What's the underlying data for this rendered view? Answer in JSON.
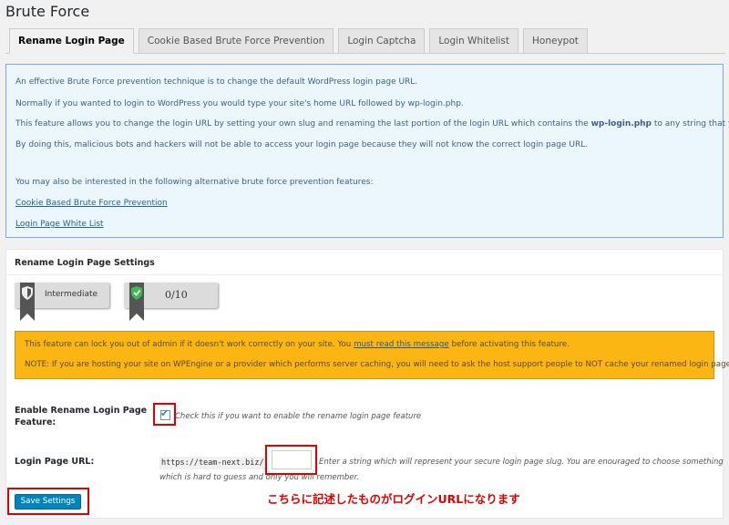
{
  "page": {
    "title": "Brute Force"
  },
  "tabs": [
    {
      "label": "Rename Login Page",
      "active": true
    },
    {
      "label": "Cookie Based Brute Force Prevention",
      "active": false
    },
    {
      "label": "Login Captcha",
      "active": false
    },
    {
      "label": "Login Whitelist",
      "active": false
    },
    {
      "label": "Honeypot",
      "active": false
    }
  ],
  "info": {
    "line1": "An effective Brute Force prevention technique is to change the default WordPress login page URL.",
    "line2": "Normally if you wanted to login to WordPress you would type your site's home URL followed by wp-login.php.",
    "line3_pre": "This feature allows you to change the login URL by setting your own slug and renaming the last portion of the login URL which contains the ",
    "line3_bold": "wp-login.php",
    "line3_post": " to any string that you like.",
    "line4": "By doing this, malicious bots and hackers will not be able to access your login page because they will not know the correct login page URL.",
    "line5": "You may also be interested in the following alternative brute force prevention features:",
    "link1": "Cookie Based Brute Force Prevention",
    "link2": "Login Page White List"
  },
  "settings": {
    "title": "Rename Login Page Settings",
    "badge_level": "Intermediate",
    "badge_score": "0/10",
    "warning_pre": "This feature can lock you out of admin if it doesn't work correctly on your site. You ",
    "warning_link": "must read this message",
    "warning_post": " before activating this feature.",
    "warning_note": "NOTE: If you are hosting your site on WPEngine or a provider which performs server caching, you will need to ask the host support people to NOT cache your renamed login page.",
    "enable_label_1": "Enable Rename Login Page",
    "enable_label_2": "Feature:",
    "enable_checked": true,
    "enable_desc": "Check this if you want to enable the rename login page feature",
    "url_label": "Login Page URL:",
    "url_prefix": "https://team-next.biz/",
    "url_value": "",
    "url_desc1": "Enter a string which will represent your secure login page slug. You are enouraged to choose something",
    "url_desc2": "which is hard to guess and only you will remember.",
    "save_label": "Save Settings"
  },
  "annotation": {
    "note": "こちらに記述したものがログインURLになります",
    "color": "#e00000"
  },
  "colors": {
    "accent": "#0085ba",
    "warning": "#fbb614",
    "info_bg": "#ecf6fd",
    "info_border": "#72aee6"
  },
  "icons": {
    "level_badge": "shield-icon",
    "score_badge": "shield-check-icon",
    "checkbox": "checkmark-icon"
  }
}
